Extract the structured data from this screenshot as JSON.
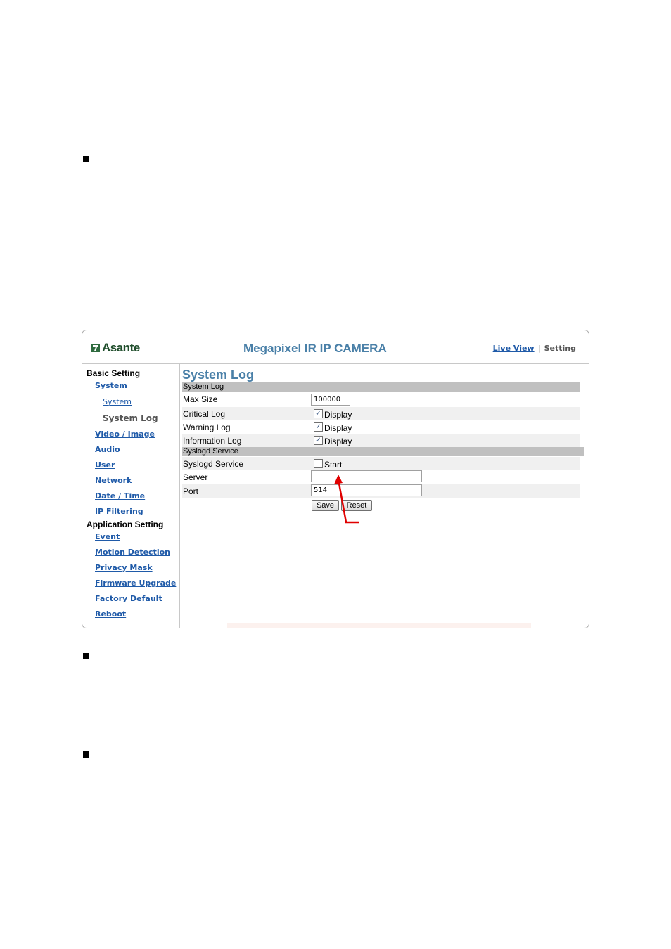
{
  "bullets": [
    "",
    "",
    ""
  ],
  "header": {
    "logo_text": "Asante",
    "title": "Megapixel IR IP CAMERA",
    "live_view": "Live View",
    "separator": "|",
    "setting": "Setting"
  },
  "sidebar": {
    "basic_heading": "Basic Setting",
    "system": "System",
    "system_sub": "System",
    "system_log": "System Log",
    "video_image": "Video / Image",
    "audio": "Audio",
    "user": "User",
    "network": "Network",
    "date_time": "Date / Time",
    "ip_filtering": "IP Filtering",
    "app_heading": "Application Setting",
    "event": "Event",
    "motion_detection": "Motion Detection",
    "privacy_mask": "Privacy Mask",
    "firmware_upgrade": "Firmware Upgrade",
    "factory_default": "Factory Default",
    "reboot": "Reboot"
  },
  "main": {
    "title": "System Log",
    "system_log_section": "System Log",
    "max_size_label": "Max Size",
    "max_size_value": "100000",
    "critical_log_label": "Critical Log",
    "critical_log_option": "Display",
    "warning_log_label": "Warning Log",
    "warning_log_option": "Display",
    "information_log_label": "Information Log",
    "information_log_option": "Display",
    "syslogd_section": "Syslogd Service",
    "syslogd_label": "Syslogd Service",
    "syslogd_option": "Start",
    "server_label": "Server",
    "server_value": "",
    "port_label": "Port",
    "port_value": "514",
    "save_label": "Save",
    "reset_label": "Reset",
    "checked_mark": "✓"
  },
  "colors": {
    "accent": "#4a80a8",
    "link": "#1f5aa8",
    "section_bar": "#c0c0c0",
    "annotation": "#e00000"
  }
}
